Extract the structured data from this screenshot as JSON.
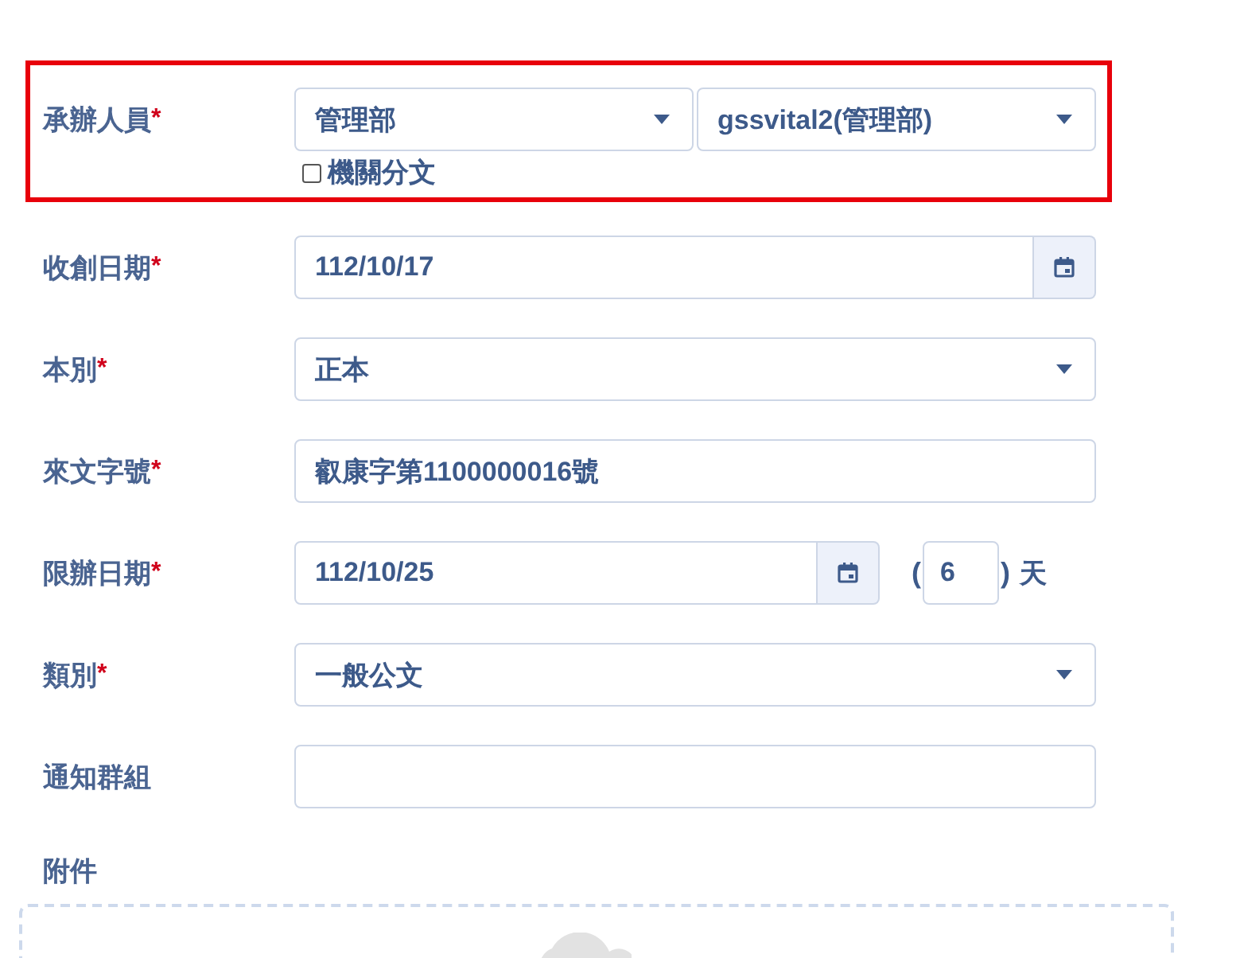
{
  "fields": [
    {
      "kind": "dual_select",
      "label": "承辦人員",
      "required_mark": "*",
      "highlighted": true,
      "selects": [
        "管理部",
        "gssvital2(管理部)"
      ],
      "checkbox": {
        "label": "機關分文",
        "checked": false
      }
    },
    {
      "kind": "date",
      "label": "收創日期",
      "required_mark": "*",
      "value": "112/10/17"
    },
    {
      "kind": "select",
      "label": "本別",
      "required_mark": "*",
      "value": "正本"
    },
    {
      "kind": "text",
      "label": "來文字號",
      "required_mark": "*",
      "value": "叡康字第1100000016號"
    },
    {
      "kind": "deadline",
      "label": "限辦日期",
      "required_mark": "*",
      "value": "112/10/25",
      "open_paren": "(",
      "days": "6",
      "close_paren": ")",
      "unit": "天"
    },
    {
      "kind": "select",
      "label": "類別",
      "required_mark": "*",
      "value": "一般公文"
    },
    {
      "kind": "text",
      "label": "通知群組"
    }
  ],
  "attachment": {
    "label": "附件"
  }
}
